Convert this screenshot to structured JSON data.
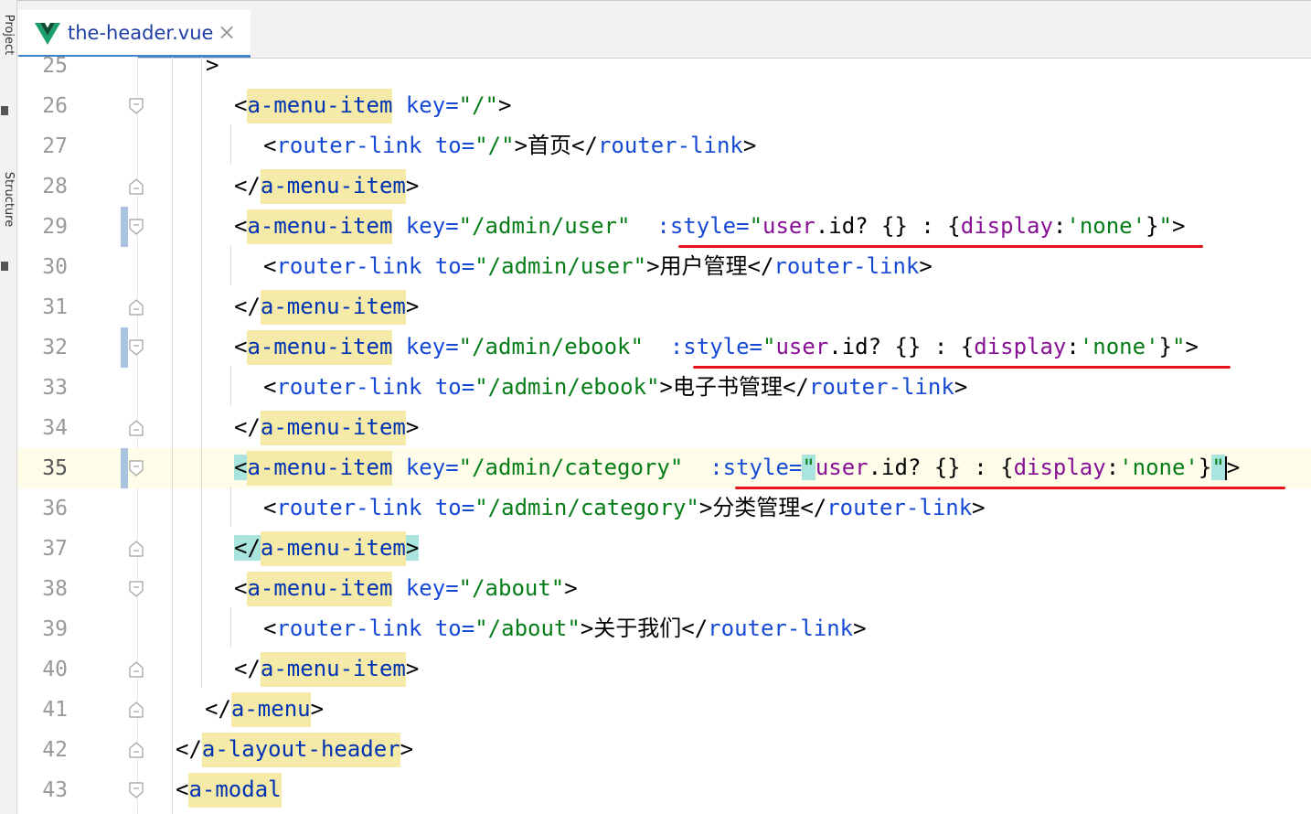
{
  "toolstrip": {
    "project_label": "Project",
    "structure_label": "Structure"
  },
  "tab": {
    "filename": "the-header.vue",
    "close_symbol": "×",
    "icon": "vue-logo-icon"
  },
  "colors": {
    "tag": "#0033b3",
    "tag_bg": "#f5eaa8",
    "attribute": "#174ad4",
    "string": "#067d17",
    "expression": "#871094",
    "annotation": "#e8131a",
    "current_line": "#fdfdea"
  },
  "lines": [
    {
      "n": "25",
      "tokens": [
        [
          "",
          ">"
        ]
      ]
    },
    {
      "n": "26",
      "tokens": [
        [
          "b",
          "<"
        ],
        [
          "t",
          "a-menu-item"
        ],
        [
          "b",
          " "
        ],
        [
          "attr",
          "key="
        ],
        [
          "str",
          "\"/\""
        ],
        [
          "b",
          ">"
        ]
      ]
    },
    {
      "n": "27",
      "tokens": [
        [
          "b",
          "<"
        ],
        [
          "attr",
          "router-link"
        ],
        [
          "b",
          " "
        ],
        [
          "attr",
          "to="
        ],
        [
          "str",
          "\"/\""
        ],
        [
          "b",
          ">"
        ],
        [
          "txt",
          "首页"
        ],
        [
          "b",
          "</"
        ],
        [
          "attr",
          "router-link"
        ],
        [
          "b",
          ">"
        ]
      ]
    },
    {
      "n": "28",
      "tokens": [
        [
          "b",
          "</"
        ],
        [
          "t",
          "a-menu-item"
        ],
        [
          "b",
          ">"
        ]
      ]
    },
    {
      "n": "29",
      "tokens": [
        [
          "b",
          "<"
        ],
        [
          "t",
          "a-menu-item"
        ],
        [
          "b",
          " "
        ],
        [
          "attr",
          "key="
        ],
        [
          "str",
          "\"/admin/user\""
        ],
        [
          "b",
          "  "
        ],
        [
          "attr",
          ":style="
        ],
        [
          "str",
          "\""
        ],
        [
          "vexp",
          "user"
        ],
        [
          "b",
          ".id? {} : {"
        ],
        [
          "vexp",
          "display"
        ],
        [
          "b",
          ":"
        ],
        [
          "str",
          "'none'"
        ],
        [
          "b",
          "}"
        ],
        [
          "str",
          "\""
        ],
        [
          "b",
          ">"
        ]
      ]
    },
    {
      "n": "30",
      "tokens": [
        [
          "b",
          "<"
        ],
        [
          "attr",
          "router-link"
        ],
        [
          "b",
          " "
        ],
        [
          "attr",
          "to="
        ],
        [
          "str",
          "\"/admin/user\""
        ],
        [
          "b",
          ">"
        ],
        [
          "txt",
          "用户管理"
        ],
        [
          "b",
          "</"
        ],
        [
          "attr",
          "router-link"
        ],
        [
          "b",
          ">"
        ]
      ]
    },
    {
      "n": "31",
      "tokens": [
        [
          "b",
          "</"
        ],
        [
          "t",
          "a-menu-item"
        ],
        [
          "b",
          ">"
        ]
      ]
    },
    {
      "n": "32",
      "tokens": [
        [
          "b",
          "<"
        ],
        [
          "t",
          "a-menu-item"
        ],
        [
          "b",
          " "
        ],
        [
          "attr",
          "key="
        ],
        [
          "str",
          "\"/admin/ebook\""
        ],
        [
          "b",
          "  "
        ],
        [
          "attr",
          ":style="
        ],
        [
          "str",
          "\""
        ],
        [
          "vexp",
          "user"
        ],
        [
          "b",
          ".id? {} : {"
        ],
        [
          "vexp",
          "display"
        ],
        [
          "b",
          ":"
        ],
        [
          "str",
          "'none'"
        ],
        [
          "b",
          "}"
        ],
        [
          "str",
          "\""
        ],
        [
          "b",
          ">"
        ]
      ]
    },
    {
      "n": "33",
      "tokens": [
        [
          "b",
          "<"
        ],
        [
          "attr",
          "router-link"
        ],
        [
          "b",
          " "
        ],
        [
          "attr",
          "to="
        ],
        [
          "str",
          "\"/admin/ebook\""
        ],
        [
          "b",
          ">"
        ],
        [
          "txt",
          "电子书管理"
        ],
        [
          "b",
          "</"
        ],
        [
          "attr",
          "router-link"
        ],
        [
          "b",
          ">"
        ]
      ]
    },
    {
      "n": "34",
      "tokens": [
        [
          "b",
          "</"
        ],
        [
          "t",
          "a-menu-item"
        ],
        [
          "b",
          ">"
        ]
      ]
    },
    {
      "n": "35",
      "tokens": [
        [
          "b",
          "<"
        ],
        [
          "t",
          "a-menu-item"
        ],
        [
          "b",
          " "
        ],
        [
          "attr",
          "key="
        ],
        [
          "str",
          "\"/admin/category\""
        ],
        [
          "b",
          "  "
        ],
        [
          "attr",
          ":style="
        ],
        [
          "str",
          "\""
        ],
        [
          "vexp",
          "user"
        ],
        [
          "b",
          ".id? {} : {"
        ],
        [
          "vexp",
          "display"
        ],
        [
          "b",
          ":"
        ],
        [
          "str",
          "'none'"
        ],
        [
          "b",
          "}"
        ],
        [
          "str",
          "\""
        ],
        [
          "b",
          ">"
        ]
      ]
    },
    {
      "n": "36",
      "tokens": [
        [
          "b",
          "<"
        ],
        [
          "attr",
          "router-link"
        ],
        [
          "b",
          " "
        ],
        [
          "attr",
          "to="
        ],
        [
          "str",
          "\"/admin/category\""
        ],
        [
          "b",
          ">"
        ],
        [
          "txt",
          "分类管理"
        ],
        [
          "b",
          "</"
        ],
        [
          "attr",
          "router-link"
        ],
        [
          "b",
          ">"
        ]
      ]
    },
    {
      "n": "37",
      "tokens": [
        [
          "b",
          "</"
        ],
        [
          "t",
          "a-menu-item"
        ],
        [
          "b",
          ">"
        ]
      ]
    },
    {
      "n": "38",
      "tokens": [
        [
          "b",
          "<"
        ],
        [
          "t",
          "a-menu-item"
        ],
        [
          "b",
          " "
        ],
        [
          "attr",
          "key="
        ],
        [
          "str",
          "\"/about\""
        ],
        [
          "b",
          ">"
        ]
      ]
    },
    {
      "n": "39",
      "tokens": [
        [
          "b",
          "<"
        ],
        [
          "attr",
          "router-link"
        ],
        [
          "b",
          " "
        ],
        [
          "attr",
          "to="
        ],
        [
          "str",
          "\"/about\""
        ],
        [
          "b",
          ">"
        ],
        [
          "txt",
          "关于我们"
        ],
        [
          "b",
          "</"
        ],
        [
          "attr",
          "router-link"
        ],
        [
          "b",
          ">"
        ]
      ]
    },
    {
      "n": "40",
      "tokens": [
        [
          "b",
          "</"
        ],
        [
          "t",
          "a-menu-item"
        ],
        [
          "b",
          ">"
        ]
      ]
    },
    {
      "n": "41",
      "tokens": [
        [
          "b",
          "</"
        ],
        [
          "t",
          "a-menu"
        ],
        [
          "b",
          ">"
        ]
      ]
    },
    {
      "n": "42",
      "tokens": [
        [
          "b",
          "</"
        ],
        [
          "t",
          "a-layout-header"
        ],
        [
          "b",
          ">"
        ]
      ]
    },
    {
      "n": "43",
      "tokens": [
        [
          "b",
          "<"
        ],
        [
          "t",
          "a-modal"
        ]
      ]
    }
  ],
  "current_line": "35"
}
